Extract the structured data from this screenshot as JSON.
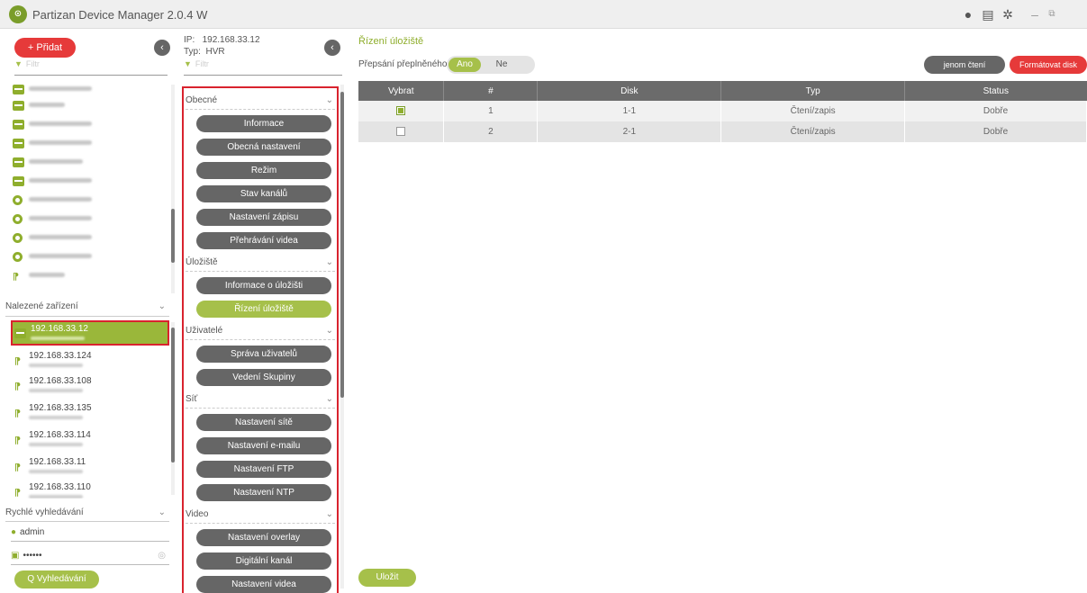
{
  "app": {
    "title": "Partizan Device Manager 2.0.4 W",
    "logo_icon": "partizan-logo-icon",
    "window_controls": [
      "plus-circle-icon",
      "list-icon",
      "gear-icon",
      "minimize-icon",
      "restore-icon"
    ]
  },
  "sidebar": {
    "add_label": "+  Přidat",
    "filter_placeholder": "Filtr",
    "found_devices_header": "Nalezené zařízení",
    "found_devices": [
      {
        "ip": "192.168.33.12",
        "selected": true
      },
      {
        "ip": "192.168.33.124",
        "selected": false
      },
      {
        "ip": "192.168.33.108",
        "selected": false
      },
      {
        "ip": "192.168.33.135",
        "selected": false
      },
      {
        "ip": "192.168.33.114",
        "selected": false
      },
      {
        "ip": "192.168.33.11",
        "selected": false
      },
      {
        "ip": "192.168.33.110",
        "selected": false
      }
    ],
    "quick_search_header": "Rychlé vyhledávání",
    "username": "admin",
    "password_mask": "••••••",
    "search_label": "Q  Vyhledávání"
  },
  "device": {
    "ip_label": "IP:",
    "ip": "192.168.33.12",
    "type_label": "Typ:",
    "type": "HVR",
    "filter_placeholder": "Filtr"
  },
  "menu": {
    "general": {
      "label": "Obecné",
      "items": [
        "Informace",
        "Obecná nastavení",
        "Režim",
        "Stav kanálů",
        "Nastavení zápisu",
        "Přehrávání videa"
      ]
    },
    "storage": {
      "label": "Úložiště",
      "items": [
        "Informace o úložišti",
        "Řízení úložiště"
      ]
    },
    "users": {
      "label": "Uživatelé",
      "items": [
        "Správa uživatelů",
        "Vedení Skupiny"
      ]
    },
    "network": {
      "label": "Síť",
      "items": [
        "Nastavení sítě",
        "Nastavení e-mailu",
        "Nastavení FTP",
        "Nastavení NTP"
      ]
    },
    "video": {
      "label": "Video",
      "items": [
        "Nastavení overlay",
        "Digitální kanál",
        "Nastavení videa"
      ]
    }
  },
  "main": {
    "title": "Řízení úložiště",
    "overwrite_label": "Přepsání přeplněného disku",
    "toggle_yes": "Ano",
    "toggle_no": "Ne",
    "readonly_label": "jenom čtení",
    "format_label": "Formátovat disk",
    "save_label": "Uložit",
    "table": {
      "headers": [
        "Vybrat",
        "#",
        "Disk",
        "Typ",
        "Status"
      ],
      "rows": [
        {
          "checked": true,
          "num": "1",
          "disk": "1-1",
          "type": "Čtení/zapis",
          "status": "Dobře"
        },
        {
          "checked": false,
          "num": "2",
          "disk": "2-1",
          "type": "Čtení/zapis",
          "status": "Dobře"
        }
      ]
    }
  },
  "colors": {
    "accent_green": "#a6c04a",
    "accent_red": "#e63a3a",
    "button_gray": "#666666"
  }
}
